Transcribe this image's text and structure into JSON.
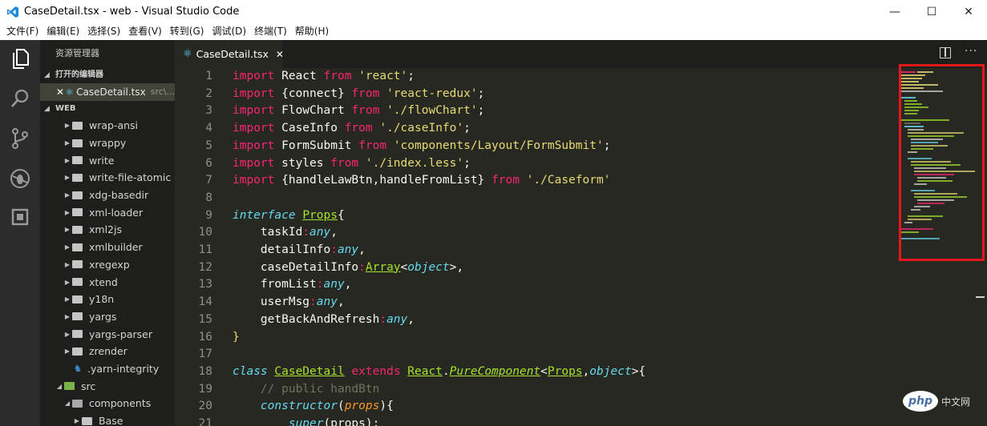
{
  "window": {
    "title": "CaseDetail.tsx - web - Visual Studio Code",
    "controls": {
      "minimize": "—",
      "maximize": "☐",
      "close": "✕"
    }
  },
  "menu": [
    "文件(F)",
    "编辑(E)",
    "选择(S)",
    "查看(V)",
    "转到(G)",
    "调试(D)",
    "终端(T)",
    "帮助(H)"
  ],
  "activity_bar": [
    "files-icon",
    "search-icon",
    "source-control-icon",
    "debug-icon",
    "extensions-icon"
  ],
  "sidebar": {
    "title": "资源管理器",
    "open_editors_label": "打开的编辑器",
    "open_editor": {
      "close": "✕",
      "name": "CaseDetail.tsx",
      "path": "src\\..."
    },
    "project_label": "WEB",
    "tree": [
      {
        "name": "wrap-ansi",
        "kind": "folder"
      },
      {
        "name": "wrappy",
        "kind": "folder"
      },
      {
        "name": "write",
        "kind": "folder"
      },
      {
        "name": "write-file-atomic",
        "kind": "folder"
      },
      {
        "name": "xdg-basedir",
        "kind": "folder"
      },
      {
        "name": "xml-loader",
        "kind": "folder"
      },
      {
        "name": "xml2js",
        "kind": "folder"
      },
      {
        "name": "xmlbuilder",
        "kind": "folder"
      },
      {
        "name": "xregexp",
        "kind": "folder"
      },
      {
        "name": "xtend",
        "kind": "folder"
      },
      {
        "name": "y18n",
        "kind": "folder"
      },
      {
        "name": "yargs",
        "kind": "folder"
      },
      {
        "name": "yargs-parser",
        "kind": "folder"
      },
      {
        "name": "zrender",
        "kind": "folder"
      },
      {
        "name": ".yarn-integrity",
        "kind": "file"
      },
      {
        "name": "src",
        "kind": "folder-open"
      },
      {
        "name": "components",
        "kind": "folder-open"
      },
      {
        "name": "Base",
        "kind": "folder"
      }
    ]
  },
  "tab": {
    "name": "CaseDetail.tsx",
    "close": "✕"
  },
  "editor_actions": {
    "more": "···"
  },
  "code": {
    "line_numbers": [
      "1",
      "2",
      "3",
      "4",
      "5",
      "6",
      "7",
      "8",
      "9",
      "10",
      "11",
      "12",
      "13",
      "14",
      "15",
      "16",
      "17",
      "18",
      "19",
      "20",
      "21"
    ]
  },
  "watermark": {
    "logo": "php",
    "text": "中文网"
  },
  "colors": {
    "editor_bg": "#272822",
    "keyword": "#f92672",
    "string": "#e6db74",
    "type": "#66d9ef",
    "class": "#a6e22e",
    "comment": "#75715e",
    "highlight_box": "#e5171c"
  }
}
